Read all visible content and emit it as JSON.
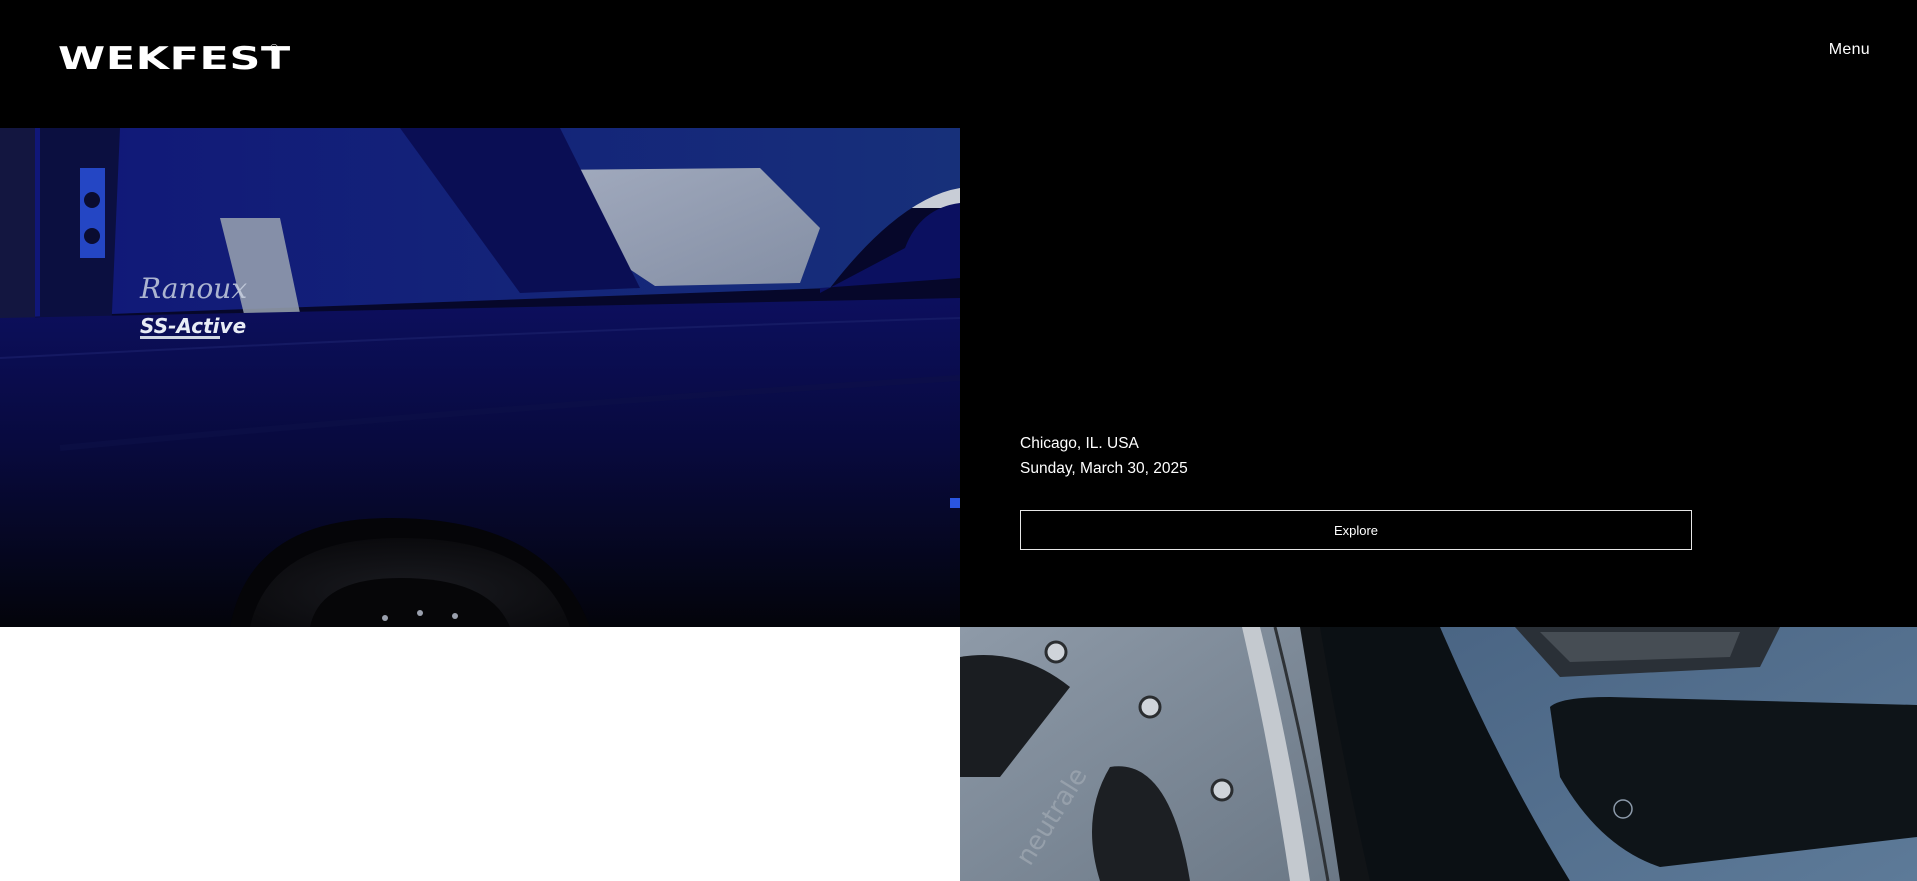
{
  "header": {
    "logo_text": "WEKFEST",
    "logo_mark": "®",
    "menu_label": "Menu"
  },
  "event": {
    "location": "Chicago, IL. USA",
    "date": "Sunday, March 30, 2025",
    "cta_label": "Explore"
  },
  "images": {
    "hero_left": "dark-blue-car-side-photo",
    "hero_right": "wheel-closeup-photo",
    "car_decal": "Ranoux SS-Active",
    "wheel_brand": "neutrale"
  },
  "colors": {
    "background": "#000000",
    "text": "#ffffff",
    "button_border": "#e6e6e6",
    "car_blue": "#0a0d52",
    "white_block": "#ffffff"
  }
}
